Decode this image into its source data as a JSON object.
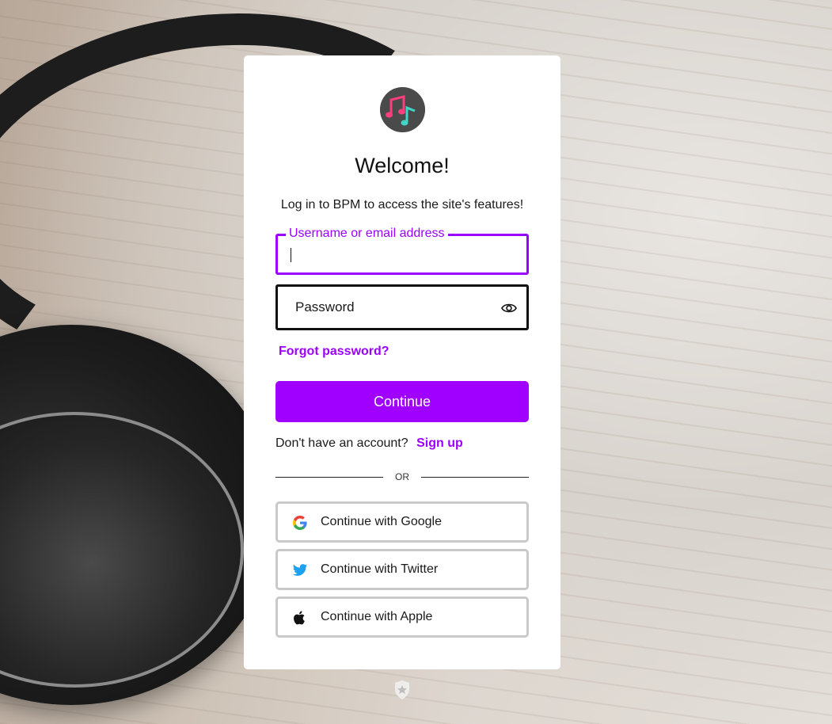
{
  "card": {
    "title": "Welcome!",
    "subtitle": "Log in to BPM to access the site's features!"
  },
  "form": {
    "username_label": "Username or email address",
    "username_value": "",
    "password_placeholder": "Password",
    "forgot_label": "Forgot password?",
    "continue_label": "Continue"
  },
  "signup": {
    "prompt": "Don't have an account?",
    "link_label": "Sign up"
  },
  "divider": {
    "label": "OR"
  },
  "social": {
    "google_label": "Continue with Google",
    "twitter_label": "Continue with Twitter",
    "apple_label": "Continue with Apple"
  },
  "icons": {
    "logo": "music-notes-logo",
    "eye": "eye-icon",
    "google": "google-icon",
    "twitter": "twitter-icon",
    "apple": "apple-icon",
    "badge": "auth0-badge-icon"
  },
  "colors": {
    "accent": "#a000ff",
    "focus_border": "#9b00ff",
    "social_border": "#c9c9c9"
  }
}
